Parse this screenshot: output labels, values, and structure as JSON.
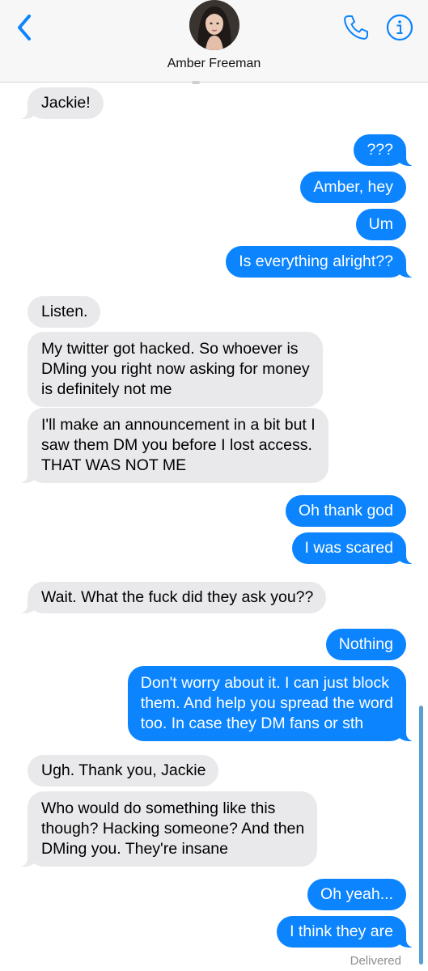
{
  "header": {
    "contact_name": "Amber Freeman",
    "accent_color": "#0b84fe",
    "icons": [
      "chevron-left-icon",
      "avatar",
      "phone-icon",
      "info-icon"
    ]
  },
  "messages": [
    {
      "from": "them",
      "text": "Jackie!"
    },
    {
      "from": "me",
      "text": "???"
    },
    {
      "from": "me",
      "text": "Amber, hey"
    },
    {
      "from": "me",
      "text": "Um"
    },
    {
      "from": "me",
      "text": "Is everything alright??"
    },
    {
      "from": "them",
      "text": "Listen."
    },
    {
      "from": "them",
      "text": "My twitter got hacked. So whoever is\nDMing you right now asking for money\nis definitely not me"
    },
    {
      "from": "them",
      "text": "I'll make an announcement in a bit but I\nsaw them DM you before I lost access.\nTHAT WAS NOT ME"
    },
    {
      "from": "me",
      "text": "Oh thank god"
    },
    {
      "from": "me",
      "text": "I was scared"
    },
    {
      "from": "them",
      "text": "Wait. What the fuck did they ask you??"
    },
    {
      "from": "me",
      "text": "Nothing"
    },
    {
      "from": "me",
      "text": "Don't worry about it. I can just block\nthem. And help you spread the word\ntoo. In case they DM fans or sth"
    },
    {
      "from": "them",
      "text": "Ugh. Thank you, Jackie"
    },
    {
      "from": "them",
      "text": "Who would do something like this\nthough? Hacking someone? And then\nDMing you. They're insane"
    },
    {
      "from": "me",
      "text": "Oh yeah..."
    },
    {
      "from": "me",
      "text": "I think they are"
    }
  ],
  "status": {
    "delivered": "Delivered"
  },
  "colors": {
    "incoming": "#e9e9eb",
    "outgoing": "#0b84fe"
  }
}
